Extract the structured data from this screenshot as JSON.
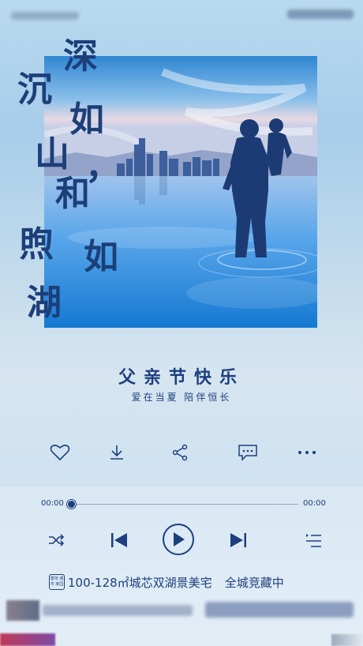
{
  "colors": {
    "primary": "#1d3f7d",
    "calligraphy": "#1c3f79"
  },
  "headline": {
    "chars": [
      "深",
      "沉",
      "如",
      "山",
      "和",
      "煦",
      "如",
      "湖"
    ],
    "comma": "，"
  },
  "title": "父亲节快乐",
  "subtitle": "爱在当夏  陪伴恒长",
  "actions": [
    {
      "icon": "heart-icon"
    },
    {
      "icon": "download-icon"
    },
    {
      "icon": "share-icon"
    },
    {
      "icon": "comment-icon"
    },
    {
      "icon": "more-icon"
    }
  ],
  "player": {
    "current_time": "00:00",
    "total_time": "00:00",
    "progress": 0,
    "controls": [
      "shuffle-icon",
      "previous-icon",
      "play-icon",
      "next-icon",
      "playlist-icon"
    ]
  },
  "promo": {
    "logo_text": "置地\n城市\n家园",
    "text": "100-128㎡城芯双湖景美宅",
    "status": "全城竞藏中"
  }
}
